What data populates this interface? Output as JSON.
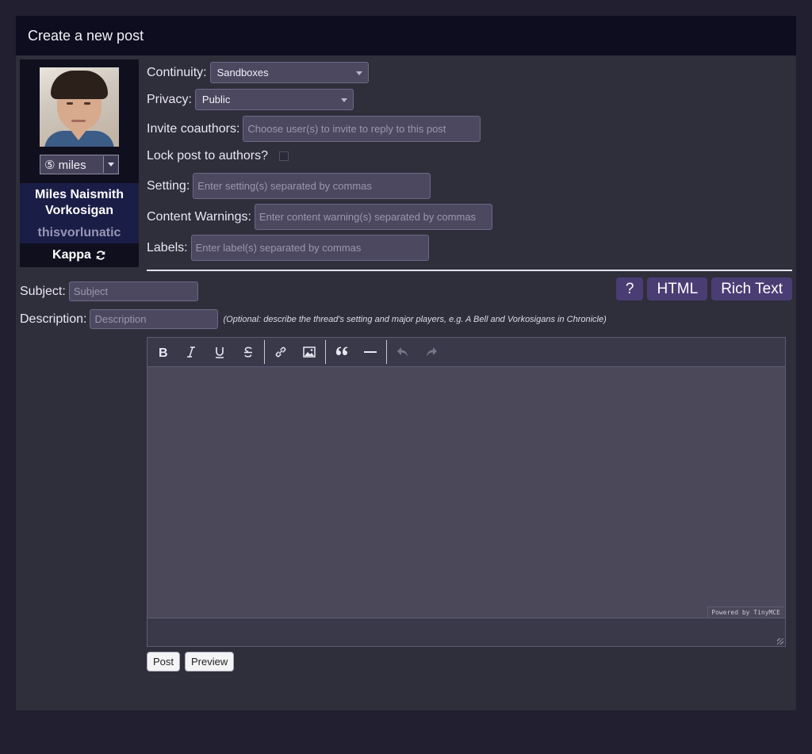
{
  "panel": {
    "title": "Create a new post"
  },
  "character": {
    "alias": "⑤ miles",
    "name": "Miles Naismith Vorkosigan",
    "username": "thisvorlunatic",
    "board": "Kappa"
  },
  "form": {
    "continuity": {
      "label": "Continuity:",
      "value": "Sandboxes"
    },
    "privacy": {
      "label": "Privacy:",
      "value": "Public"
    },
    "coauthors": {
      "label": "Invite coauthors:",
      "placeholder": "Choose user(s) to invite to reply to this post"
    },
    "lock": {
      "label": "Lock post to authors?"
    },
    "setting": {
      "label": "Setting:",
      "placeholder": "Enter setting(s) separated by commas"
    },
    "warnings": {
      "label": "Content Warnings:",
      "placeholder": "Enter content warning(s) separated by commas"
    },
    "labels": {
      "label": "Labels:",
      "placeholder": "Enter label(s) separated by commas"
    },
    "subject": {
      "label": "Subject:",
      "placeholder": "Subject"
    },
    "description": {
      "label": "Description:",
      "placeholder": "Description",
      "hint": "(Optional: describe the thread's setting and major players, e.g. A Bell and Vorkosigans in Chronicle)"
    }
  },
  "editor_tabs": {
    "help": "?",
    "html": "HTML",
    "rich": "Rich Text"
  },
  "editor": {
    "tools": [
      "bold-icon",
      "italic-icon",
      "underline-icon",
      "strikethrough-icon",
      "link-icon",
      "image-icon",
      "blockquote-icon",
      "horizontal-rule-icon",
      "undo-icon",
      "redo-icon"
    ],
    "powered_by": "Powered by TinyMCE"
  },
  "actions": {
    "post": "Post",
    "preview": "Preview"
  },
  "colors": {
    "accent": "#4a3d74",
    "header_bg": "#0e0d1f",
    "panel_bg": "#2f2e3b",
    "page_bg": "#211f30"
  }
}
